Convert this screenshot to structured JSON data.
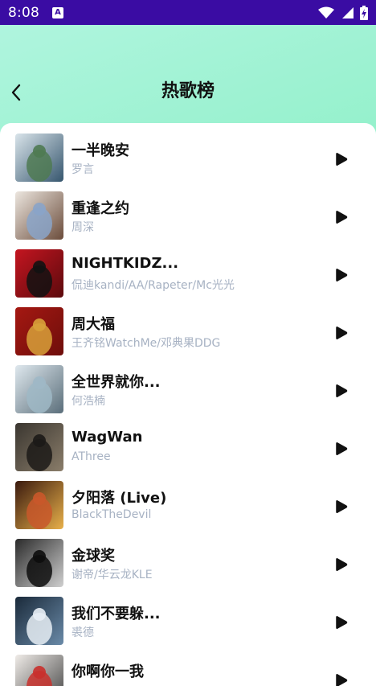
{
  "status_bar": {
    "time": "8:08",
    "badge": "A"
  },
  "header": {
    "title": "热歌榜"
  },
  "songs": [
    {
      "title": "一半晚安",
      "artist": "罗言",
      "colors": [
        "#d9e4ea",
        "#4f7a52",
        "#36566e"
      ]
    },
    {
      "title": "重逢之约",
      "artist": "周深",
      "colors": [
        "#ece6df",
        "#8aa4c9",
        "#6b4c3b"
      ]
    },
    {
      "title": "NIGHTKIDZ...",
      "artist": "侃迪kandi/AA/Rapeter/Mc光光",
      "colors": [
        "#c41520",
        "#121212",
        "#5c0a0d"
      ]
    },
    {
      "title": "周大福",
      "artist": "王齐铭WatchMe/邓典果DDG",
      "colors": [
        "#a51812",
        "#d8a13a",
        "#6e0e0b"
      ]
    },
    {
      "title": "全世界就你...",
      "artist": "何浩楠",
      "colors": [
        "#dfe8ee",
        "#9fb8c6",
        "#5a6e7a"
      ]
    },
    {
      "title": "WagWan",
      "artist": "AThree",
      "colors": [
        "#3a3630",
        "#1c1a17",
        "#8a7d6a"
      ]
    },
    {
      "title": "夕阳落 (Live)",
      "artist": "BlackTheDevil",
      "colors": [
        "#3a1a0e",
        "#c9582a",
        "#e8b04a"
      ]
    },
    {
      "title": "金球奖",
      "artist": "谢帝/华云龙KLE",
      "colors": [
        "#2a2a2a",
        "#0d0d0d",
        "#cfcfcf"
      ]
    },
    {
      "title": "我们不要躲...",
      "artist": "裘德",
      "colors": [
        "#1a2a3a",
        "#e8eef5",
        "#6a8aa8"
      ]
    },
    {
      "title": "你啊你一我",
      "artist": "",
      "colors": [
        "#f0ece8",
        "#c9302c",
        "#444444"
      ]
    }
  ]
}
